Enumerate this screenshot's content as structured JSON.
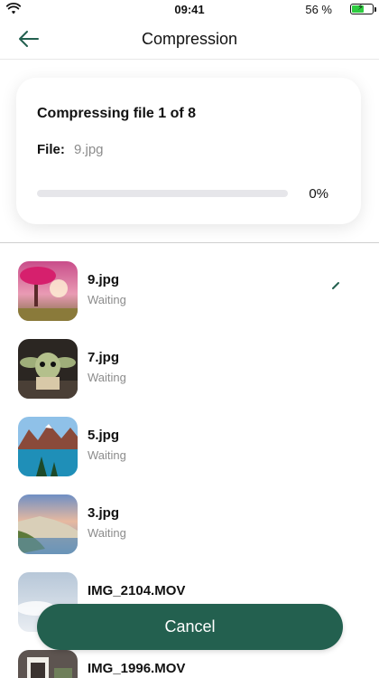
{
  "status_bar": {
    "time": "09:41",
    "battery_percent": "56 %",
    "battery_level": 0.56
  },
  "nav": {
    "title": "Compression",
    "back_icon": "arrow-left-icon"
  },
  "progress": {
    "heading": "Compressing file 1 of 8",
    "file_label": "File:",
    "file_name": "9.jpg",
    "percent_text": "0%",
    "percent": 0
  },
  "files": [
    {
      "name": "9.jpg",
      "status": "Waiting"
    },
    {
      "name": "7.jpg",
      "status": "Waiting"
    },
    {
      "name": "5.jpg",
      "status": "Waiting"
    },
    {
      "name": "3.jpg",
      "status": "Waiting"
    },
    {
      "name": "IMG_2104.MOV",
      "status": ""
    },
    {
      "name": "IMG_1996.MOV",
      "status": ""
    }
  ],
  "cancel_label": "Cancel",
  "colors": {
    "accent": "#23604f",
    "track": "#e6e6ea",
    "muted_text": "#8c8c8c"
  }
}
